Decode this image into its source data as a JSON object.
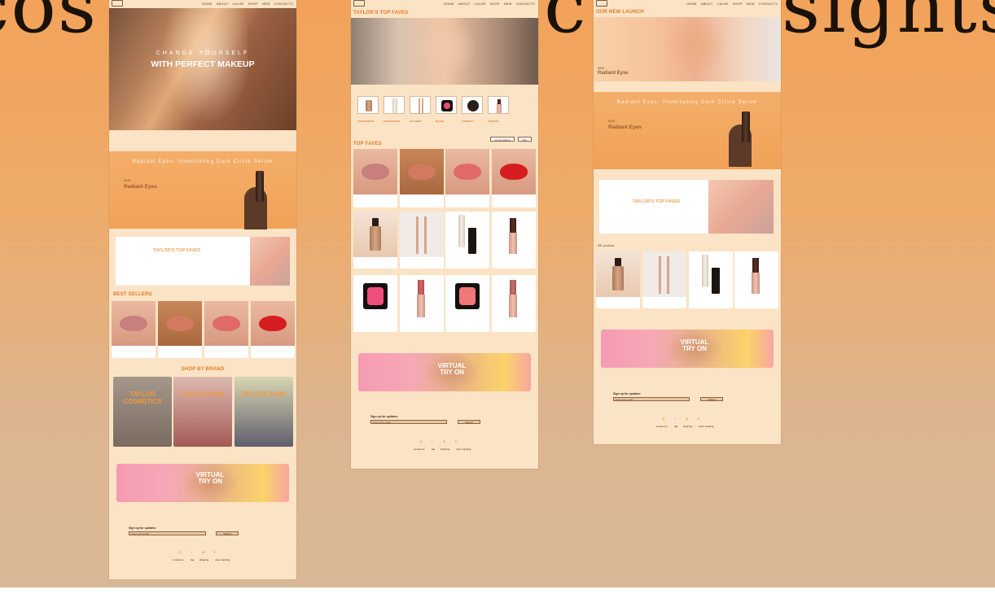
{
  "background_words": {
    "left": "cos",
    "middle": "ctt",
    "right": "sights"
  },
  "nav": {
    "items": [
      "HOME",
      "ABOUT",
      "CALIRI",
      "SHOP",
      "NEW",
      "CONTACTS"
    ]
  },
  "home": {
    "hero_line1": "CHANGE YOURSELF",
    "hero_line2": "WITH PERFECT MAKEUP",
    "serum_title": "Radiant Eyes: Illuminating Dark Circle Serum",
    "serum_new": "NEW",
    "serum_name": "Radiant Eyes",
    "faves_title": "TAYLOR'S TOP FAVES",
    "best_sellers_title": "BEST SELLERS",
    "shop_by_brand_title": "SHOP BY BRAND",
    "brands": [
      "TAYLOR COSMETICS",
      "TAYLOR SKIN",
      "TAYLOR BABY"
    ],
    "virtual_try_on": "VIRTUAL TRY ON",
    "signup_label": "Sign up for updates:",
    "signup_placeholder": "enter your email",
    "signup_button": "Submit",
    "footer_links": [
      "contact us",
      "faq",
      "shipping",
      "order tracking"
    ]
  },
  "faves_page": {
    "title": "TAYLOR'S TOP FAVES",
    "categories": [
      "FOUNDATION",
      "EYESHADOW",
      "LIP LINER",
      "BLUSH",
      "COMPACT",
      "LIPSTICK"
    ],
    "sort_label": "sort by feature",
    "filter_label": "filter",
    "top_faves_title": "TOP FAVES",
    "virtual_try_on": "VIRTUAL TRY ON",
    "signup_label": "Sign up for updates:",
    "signup_placeholder": "enter your email",
    "signup_button": "Submit",
    "footer_links": [
      "contact us",
      "faq",
      "shipping",
      "order tracking"
    ]
  },
  "launch_page": {
    "title": "OUR NEW LAUNCH",
    "hero_new": "NEW",
    "hero_name": "Radiant Eyse",
    "serum_title": "Radiant Eyes: Illuminating Dark Circle Serum",
    "serum_new": "NEW",
    "serum_name": "Radiant Eyes",
    "faves_title": "TAYLOR'S TOP FAVES",
    "products_label": "581 products",
    "virtual_try_on": "VIRTUAL TRY ON",
    "signup_label": "Sign up for updates:",
    "signup_placeholder": "enter your email",
    "signup_button": "Submit",
    "footer_links": [
      "contact us",
      "faq",
      "shipping",
      "order tracking"
    ]
  },
  "colors": {
    "accent": "#e07b2a",
    "page_bg": "#fbe3c5",
    "lips": [
      "#c97f7e",
      "#d27a5e",
      "#e06a68",
      "#d61d22"
    ],
    "blush": [
      "#ef4e7a",
      "#f0777a"
    ]
  }
}
